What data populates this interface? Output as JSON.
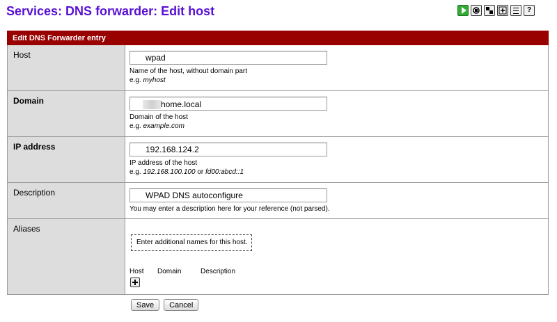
{
  "page": {
    "title": "Services: DNS forwarder: Edit host"
  },
  "toolbar": {
    "icons": [
      "play-icon",
      "cpu-icon",
      "network-icon",
      "add-icon",
      "list-icon",
      "help-icon"
    ],
    "help_glyph": "?"
  },
  "section": {
    "title": "Edit DNS Forwarder entry"
  },
  "form": {
    "host": {
      "label": "Host",
      "value": "wpad",
      "hint": "Name of the host, without domain part",
      "example_prefix": "e.g. ",
      "example": "myhost"
    },
    "domain": {
      "label": "Domain",
      "value": "home.local",
      "hint": "Domain of the host",
      "example_prefix": "e.g. ",
      "example": "example.com"
    },
    "ip": {
      "label": "IP address",
      "value": "192.168.124.2",
      "hint": "IP address of the host",
      "example_prefix": "e.g. ",
      "example1": "192.168.100.100",
      "or_text": " or ",
      "example2": "fd00:abcd::1"
    },
    "description": {
      "label": "Description",
      "value": "WPAD DNS autoconfigure",
      "hint": "You may enter a description here for your reference (not parsed)."
    },
    "aliases": {
      "label": "Aliases",
      "note": "Enter additional names for this host.",
      "columns": [
        "Host",
        "Domain",
        "Description"
      ]
    }
  },
  "actions": {
    "save_label": "Save",
    "cancel_label": "Cancel"
  },
  "colors": {
    "title": "#5810d4",
    "header_bg": "#990000",
    "label_bg": "#dddddd"
  }
}
